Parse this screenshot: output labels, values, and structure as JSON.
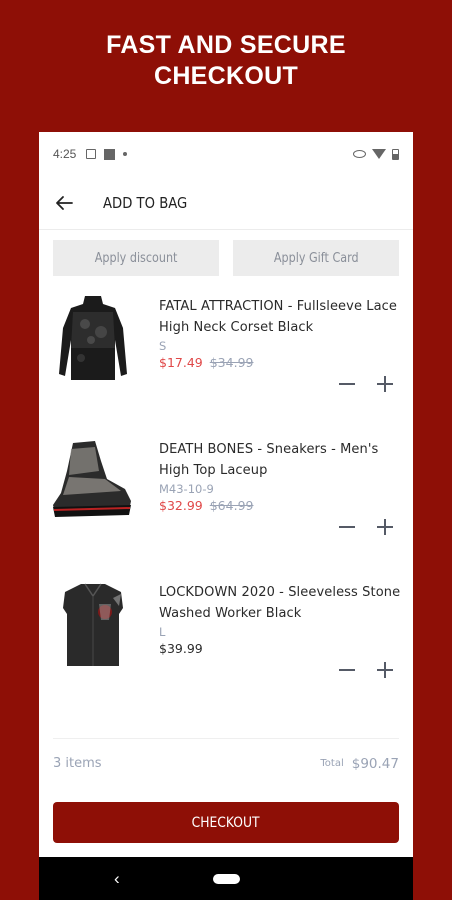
{
  "promo": {
    "line1": "FAST AND SECURE",
    "line2": "CHECKOUT"
  },
  "status_bar": {
    "time": "4:25",
    "icons": [
      "image-icon",
      "sim-icon",
      "dot-icon",
      "eye-icon",
      "wifi-icon",
      "battery-icon"
    ]
  },
  "app_bar": {
    "back_icon": "arrow-left-icon",
    "title": "ADD TO BAG"
  },
  "promo_buttons": {
    "discount": "Apply discount",
    "gift_card": "Apply Gift Card"
  },
  "items": [
    {
      "name": "FATAL ATTRACTION - Fullsleeve Lace High Neck Corset Black",
      "variant": "S",
      "sale_price": "$17.49",
      "original_price": "$34.99"
    },
    {
      "name": "DEATH BONES - Sneakers - Men's High Top Laceup",
      "variant": "M43-10-9",
      "sale_price": "$32.99",
      "original_price": "$64.99"
    },
    {
      "name": "LOCKDOWN 2020 - Sleeveless Stone Washed Worker Black",
      "variant": "L",
      "price": "$39.99"
    }
  ],
  "summary": {
    "count": "3 items",
    "total_label": "Total",
    "total_value": "$90.47"
  },
  "checkout_label": "CHECKOUT",
  "nav_bar": {
    "back_glyph": "‹"
  },
  "colors": {
    "brand": "#8e0f06",
    "sale": "#e04848",
    "muted": "#9aa3b5"
  }
}
